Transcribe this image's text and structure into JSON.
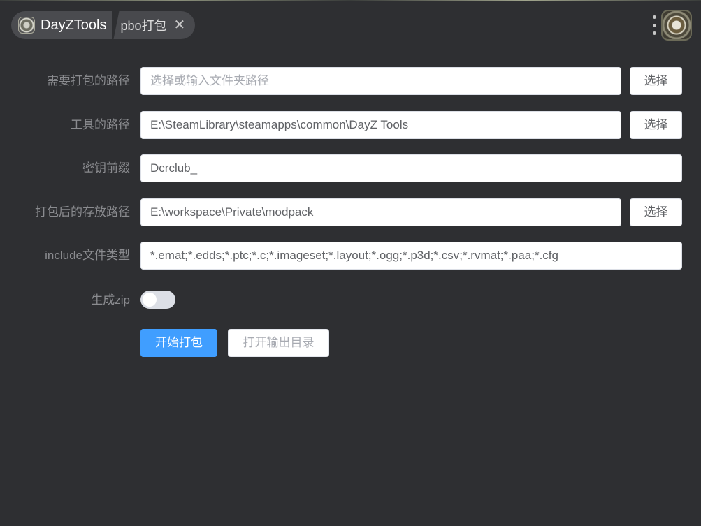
{
  "header": {
    "app_tab": {
      "label": "DayZTools",
      "icon": "dayz-logo-icon"
    },
    "active_tab": {
      "label": "pbo打包",
      "close_glyph": "✕"
    },
    "menu_icon": "kebab-menu-icon",
    "avatar_icon": "dayz-logo-avatar"
  },
  "form": {
    "pack_path": {
      "label": "需要打包的路径",
      "value": "",
      "placeholder": "选择或输入文件夹路径",
      "button": "选择"
    },
    "tool_path": {
      "label": "工具的路径",
      "value": "E:\\SteamLibrary\\steamapps\\common\\DayZ Tools",
      "button": "选择"
    },
    "key_prefix": {
      "label": "密钥前缀",
      "value": "Dcrclub_"
    },
    "output_path": {
      "label": "打包后的存放路径",
      "value": "E:\\workspace\\Private\\modpack",
      "button": "选择"
    },
    "include_types": {
      "label": "include文件类型",
      "value": "*.emat;*.edds;*.ptc;*.c;*.imageset;*.layout;*.ogg;*.p3d;*.csv;*.rvmat;*.paa;*.cfg"
    },
    "zip": {
      "label": "生成zip",
      "enabled": false
    },
    "actions": {
      "start": "开始打包",
      "open_output": "打开输出目录"
    }
  },
  "colors": {
    "background": "#2e2f32",
    "primary": "#409eff",
    "label": "#8a8b8f"
  }
}
